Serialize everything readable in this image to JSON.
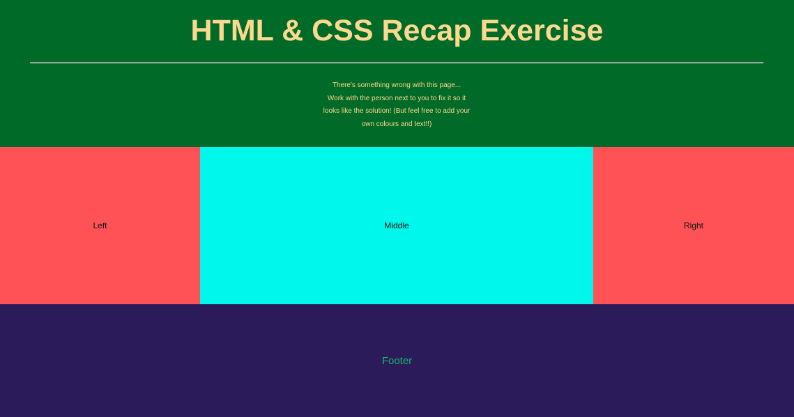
{
  "colors": {
    "header_bg": "#006a28",
    "title_color": "#fcd98e",
    "side_columns_bg": "#ff5257",
    "middle_column_bg": "#00f7ec",
    "footer_bg": "#2b1b5a",
    "footer_text": "#16b86a"
  },
  "header": {
    "title": "HTML & CSS Recap Exercise",
    "intro_lines": [
      "There's something wrong with this page...",
      "Work with the person next to you to fix it so it",
      "looks like the solution! (But feel free to add your",
      "own colours and text!!)"
    ]
  },
  "columns": {
    "left": "Left",
    "middle": "Middle",
    "right": "Right"
  },
  "footer": {
    "text": "Footer"
  }
}
